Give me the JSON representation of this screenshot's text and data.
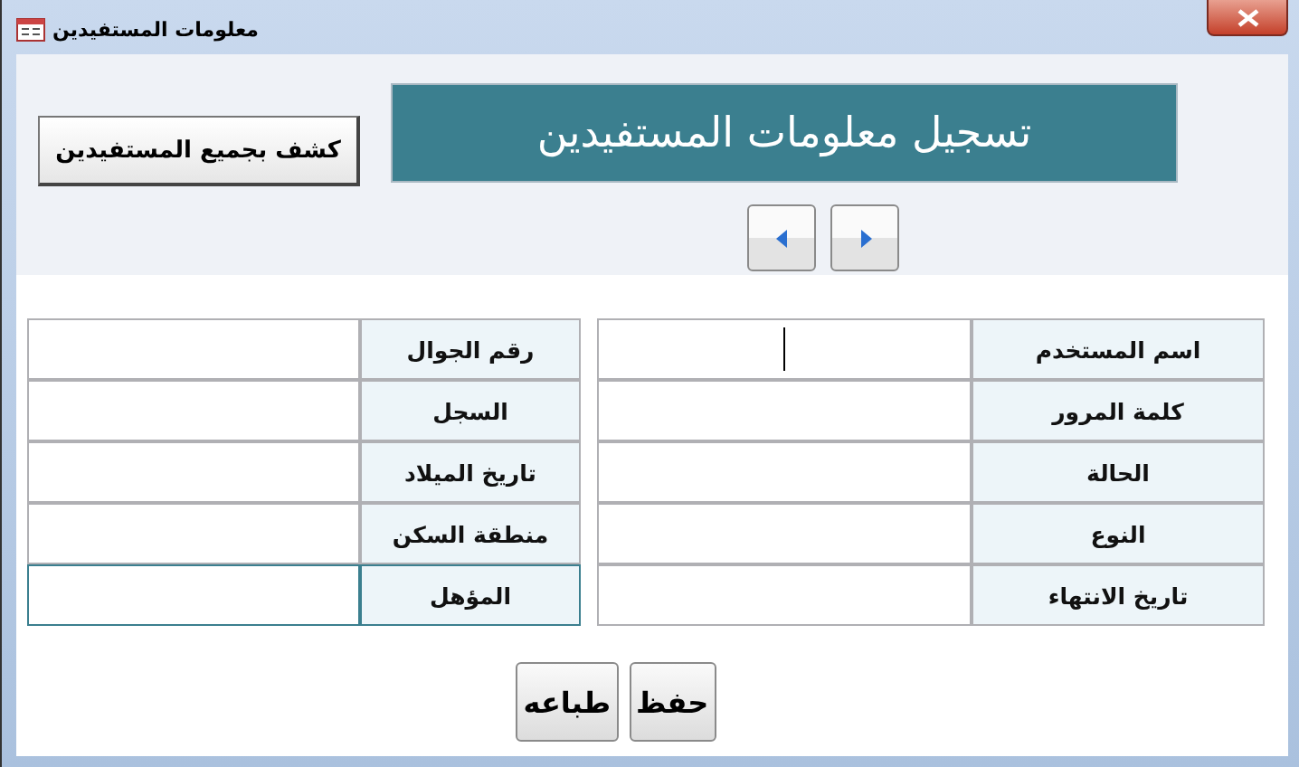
{
  "window": {
    "title": "معلومات المستفيدين"
  },
  "header": {
    "title": "تسجيل معلومات المستفيدين",
    "report_button": "كشف بجميع المستفيدين"
  },
  "record_nav": [
    {
      "kind": "previous"
    },
    {
      "kind": "next"
    }
  ],
  "right_fields": [
    {
      "label": "اسم المستخدم",
      "focused": true,
      "active": false
    },
    {
      "label": "كلمة المرور",
      "focused": false,
      "active": false
    },
    {
      "label": "الحالة",
      "focused": false,
      "active": false
    },
    {
      "label": "النوع",
      "focused": false,
      "active": false
    },
    {
      "label": "تاريخ الانتهاء",
      "focused": false,
      "active": false
    }
  ],
  "left_fields": [
    {
      "label": "رقم الجوال",
      "focused": false,
      "active": false
    },
    {
      "label": "السجل",
      "focused": false,
      "active": false
    },
    {
      "label": "تاريخ الميلاد",
      "focused": false,
      "active": false
    },
    {
      "label": "منطقة السكن",
      "focused": false,
      "active": false
    },
    {
      "label": "المؤهل",
      "focused": false,
      "active": true
    }
  ],
  "actions": [
    "حفظ",
    "طباعه"
  ]
}
